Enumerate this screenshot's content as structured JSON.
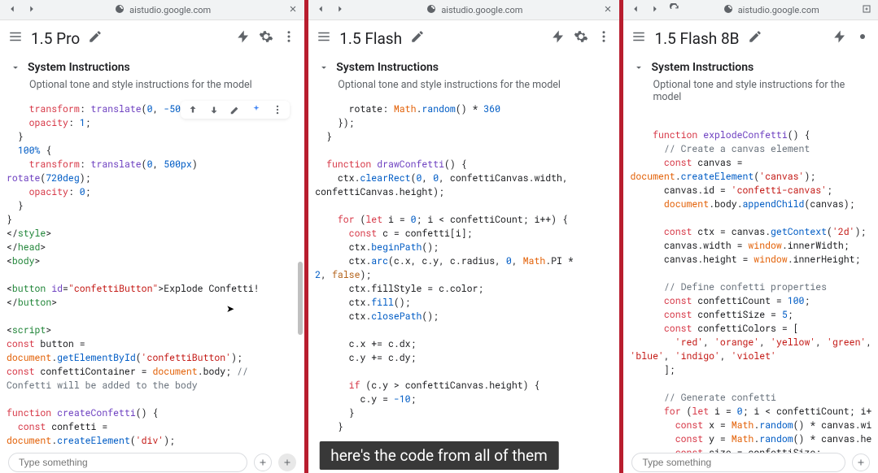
{
  "browser": {
    "url": "aistudio.google.com"
  },
  "panes": [
    {
      "title": "1.5 Pro",
      "sys_title": "System Instructions",
      "sys_sub": "Optional tone and style instructions for the model",
      "input_placeholder": "Type something",
      "code_html": "    <span class='k-prop'>transform</span>: <span class='k-func'>translate</span>(<span class='k-num'>0</span>, <span class='k-num'>-50px</span>) <span class='k-func'>rotate</span>(<span class='k-num'>0deg</span>);\n    <span class='k-prop'>opacity</span>: <span class='k-num'>1</span>;\n  }\n  <span class='k-num'>100%</span> {\n    <span class='k-prop'>transform</span>: <span class='k-func'>translate</span>(<span class='k-num'>0</span>, <span class='k-num'>500px</span>)\n<span class='k-func'>rotate</span>(<span class='k-num'>720deg</span>);\n    <span class='k-prop'>opacity</span>: <span class='k-num'>0</span>;\n  }\n}\n&lt;/<span class='k-tag'>style</span>&gt;\n&lt;/<span class='k-tag'>head</span>&gt;\n&lt;<span class='k-tag'>body</span>&gt;\n\n&lt;<span class='k-tag'>button</span> <span class='k-attr'>id</span>=<span class='k-str'>\"confettiButton\"</span>&gt;Explode Confetti!\n&lt;/<span class='k-tag'>button</span>&gt;\n\n&lt;<span class='k-tag'>script</span>&gt;\n<span class='k-kw'>const</span> button =\n<span class='k-global'>document</span>.<span class='k-call'>getElementById</span>(<span class='k-str'>'confettiButton'</span>);\n<span class='k-kw'>const</span> confettiContainer = <span class='k-global'>document</span>.body; <span class='k-com'>//</span>\n<span class='k-com'>Confetti will be added to the body</span>\n\n<span class='k-kw'>function</span> <span class='k-func'>createConfetti</span>() {\n  <span class='k-kw'>const</span> confetti =\n<span class='k-global'>document</span>.<span class='k-call'>createElement</span>(<span class='k-str'>'div'</span>);"
    },
    {
      "title": "1.5 Flash",
      "sys_title": "System Instructions",
      "sys_sub": "Optional tone and style instructions for the model",
      "input_placeholder": "Type something",
      "code_html": "      rotate: <span class='k-global'>Math</span>.<span class='k-call'>random</span>() * <span class='k-num'>360</span>\n    });\n  }\n\n  <span class='k-kw'>function</span> <span class='k-func'>drawConfetti</span>() {\n    ctx.<span class='k-call'>clearRect</span>(<span class='k-num'>0</span>, <span class='k-num'>0</span>, confettiCanvas.width,\nconfettiCanvas.height);\n\n    <span class='k-kw'>for</span> (<span class='k-kw'>let</span> i = <span class='k-num'>0</span>; i &lt; confettiCount; i++) {\n      <span class='k-kw'>const</span> c = confetti[i];\n      ctx.<span class='k-call'>beginPath</span>();\n      ctx.<span class='k-call'>arc</span>(c.x, c.y, c.radius, <span class='k-num'>0</span>, <span class='k-global'>Math</span>.PI *\n<span class='k-num'>2</span>, <span class='k-bool'>false</span>);\n      ctx.fillStyle = c.color;\n      ctx.<span class='k-call'>fill</span>();\n      ctx.<span class='k-call'>closePath</span>();\n\n      c.x += c.dx;\n      c.y += c.dy;\n\n      <span class='k-kw'>if</span> (c.y &gt; confettiCanvas.height) {\n        c.y = <span class='k-num'>-10</span>;\n      }\n    }"
    },
    {
      "title": "1.5 Flash 8B",
      "sys_title": "System Instructions",
      "sys_sub": "Optional tone and style instructions for the model",
      "input_placeholder": "Type something",
      "code_html": "\n    <span class='k-kw'>function</span> <span class='k-func'>explodeConfetti</span>() {\n      <span class='k-com'>// Create a canvas element</span>\n      <span class='k-kw'>const</span> canvas =\n<span class='k-global'>document</span>.<span class='k-call'>createElement</span>(<span class='k-str'>'canvas'</span>);\n      canvas.id = <span class='k-str'>'confetti-canvas'</span>;\n      <span class='k-global'>document</span>.body.<span class='k-call'>appendChild</span>(canvas);\n\n      <span class='k-kw'>const</span> ctx = canvas.<span class='k-call'>getContext</span>(<span class='k-str'>'2d'</span>);\n      canvas.width = <span class='k-global'>window</span>.innerWidth;\n      canvas.height = <span class='k-global'>window</span>.innerHeight;\n\n      <span class='k-com'>// Define confetti properties</span>\n      <span class='k-kw'>const</span> confettiCount = <span class='k-num'>100</span>;\n      <span class='k-kw'>const</span> confettiSize = <span class='k-num'>5</span>;\n      <span class='k-kw'>const</span> confettiColors = [\n        <span class='k-str'>'red'</span>, <span class='k-str'>'orange'</span>, <span class='k-str'>'yellow'</span>, <span class='k-str'>'green'</span>,\n<span class='k-str'>'blue'</span>, <span class='k-str'>'indigo'</span>, <span class='k-str'>'violet'</span>\n      ];\n\n      <span class='k-com'>// Generate confetti</span>\n      <span class='k-kw'>for</span> (<span class='k-kw'>let</span> i = <span class='k-num'>0</span>; i &lt; confettiCount; i++) {\n        <span class='k-kw'>const</span> x = <span class='k-global'>Math</span>.<span class='k-call'>random</span>() * canvas.width\n        <span class='k-kw'>const</span> y = <span class='k-global'>Math</span>.<span class='k-call'>random</span>() * canvas.heigh\n        <span class='k-kw'>const</span> size = confettiSize;\n        <span class='k-kw'>const</span> color ="
    }
  ],
  "subtitle": "here's the code from all of them"
}
